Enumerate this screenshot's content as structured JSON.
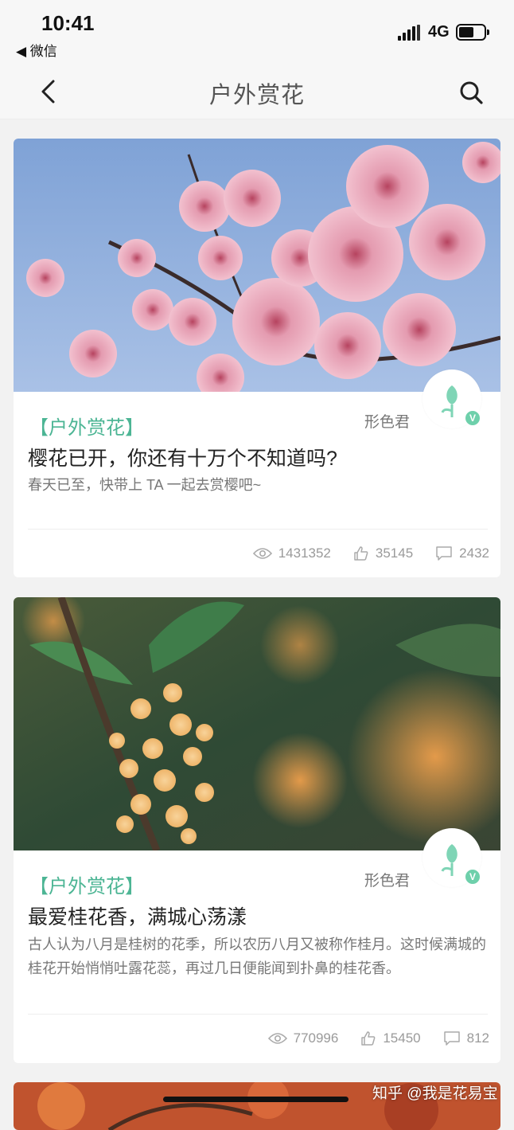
{
  "status_bar": {
    "time": "10:41",
    "back_app": "◀ 微信",
    "network": "4G"
  },
  "navbar": {
    "title": "户外赏花"
  },
  "posts": [
    {
      "tag": "【户外赏花】",
      "author": "形色君",
      "title": "樱花已开，你还有十万个不知道吗?",
      "desc": "春天已至，快带上 TA 一起去赏樱吧~",
      "views": "1431352",
      "likes": "35145",
      "comments": "2432",
      "verified": "V"
    },
    {
      "tag": "【户外赏花】",
      "author": "形色君",
      "title": "最爱桂花香，满城心荡漾",
      "desc": "古人认为八月是桂树的花季，所以农历八月又被称作桂月。这时候满城的桂花开始悄悄吐露花蕊，再过几日便能闻到扑鼻的桂花香。",
      "views": "770996",
      "likes": "15450",
      "comments": "812",
      "verified": "V"
    }
  ],
  "watermark": "知乎 @我是花易宝",
  "colors": {
    "accent": "#4cb594",
    "verify": "#6ed0ab"
  }
}
